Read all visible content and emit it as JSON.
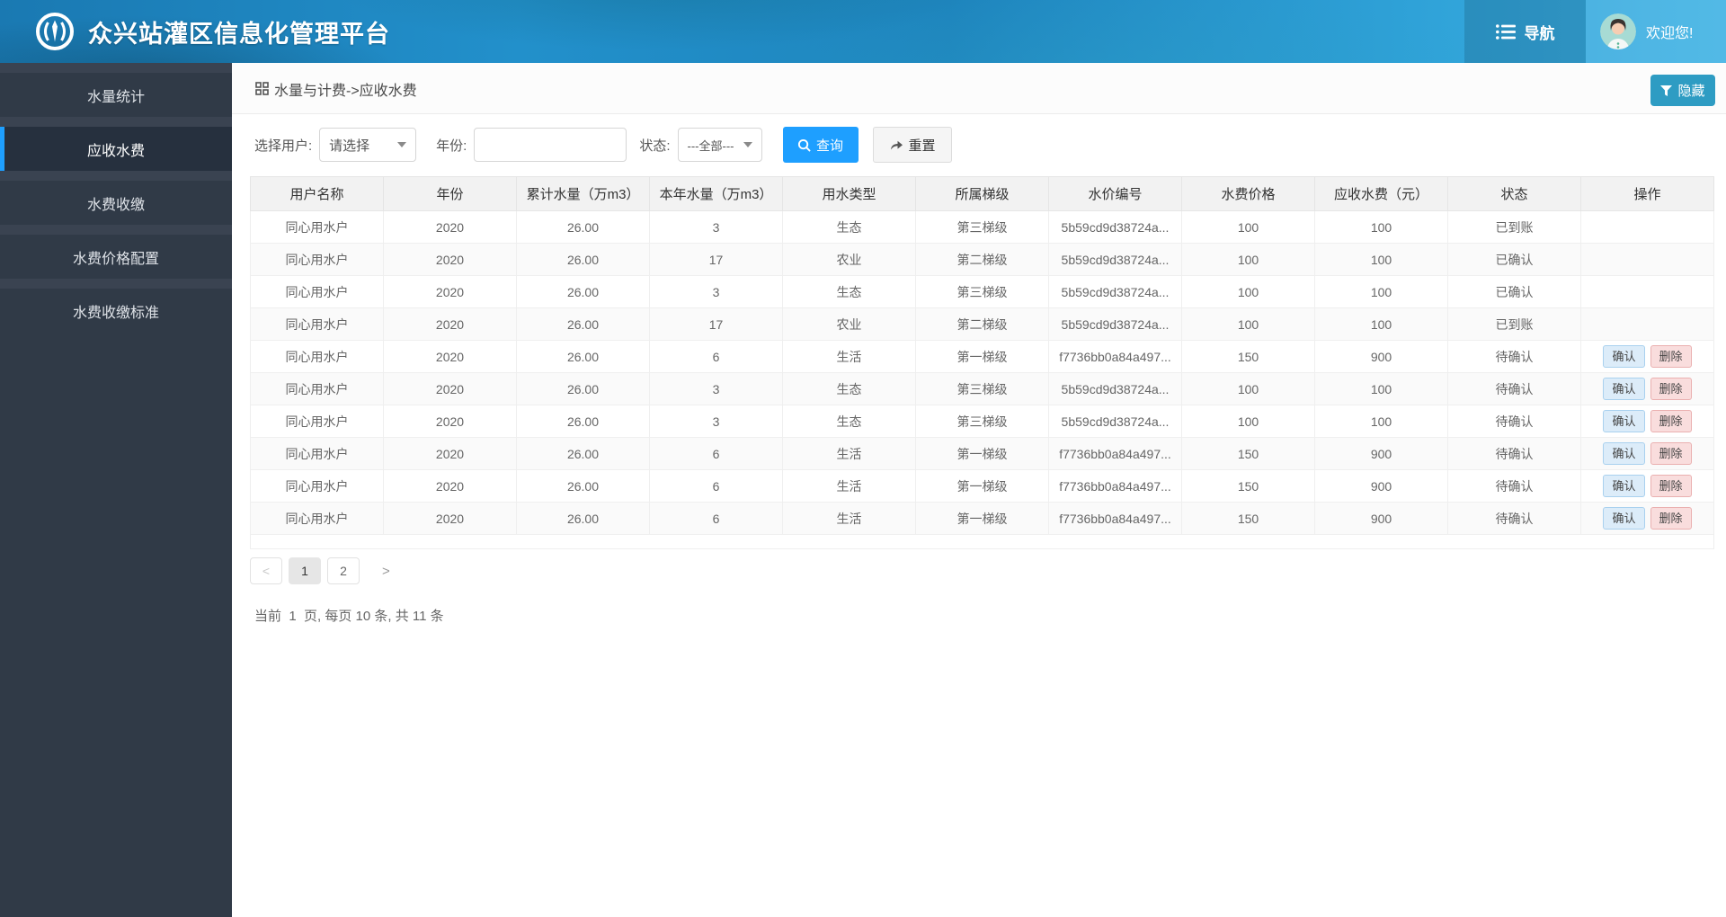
{
  "header": {
    "title": "众兴站灌区信息化管理平台",
    "nav_label": "导航",
    "welcome": "欢迎您!"
  },
  "sidebar": {
    "items": [
      {
        "key": "water-stats",
        "label": "水量统计",
        "active": false
      },
      {
        "key": "receivable-fees",
        "label": "应收水费",
        "active": true
      },
      {
        "key": "fee-collection",
        "label": "水费收缴",
        "active": false
      },
      {
        "key": "fee-price-config",
        "label": "水费价格配置",
        "active": false
      },
      {
        "key": "fee-collection-standard",
        "label": "水费收缴标准",
        "active": false
      }
    ]
  },
  "breadcrumb": {
    "text": "水量与计费->应收水费"
  },
  "toolbar": {
    "hide_label": "隐藏"
  },
  "filters": {
    "user_label": "选择用户:",
    "user_value": "请选择",
    "year_label": "年份:",
    "year_value": "",
    "status_label": "状态:",
    "status_value": "---全部---",
    "search_label": "查询",
    "reset_label": "重置"
  },
  "table": {
    "columns": [
      "用户名称",
      "年份",
      "累计水量（万m3）",
      "本年水量（万m3）",
      "用水类型",
      "所属梯级",
      "水价编号",
      "水费价格",
      "应收水费（元）",
      "状态",
      "操作"
    ],
    "confirm_label": "确认",
    "delete_label": "删除",
    "rows": [
      {
        "user": "同心用水户",
        "year": "2020",
        "total": "26.00",
        "current": "3",
        "type": "生态",
        "tier": "第三梯级",
        "price_id": "5b59cd9d38724a...",
        "price": "100",
        "amount": "100",
        "status": "已到账",
        "actions": false
      },
      {
        "user": "同心用水户",
        "year": "2020",
        "total": "26.00",
        "current": "17",
        "type": "农业",
        "tier": "第二梯级",
        "price_id": "5b59cd9d38724a...",
        "price": "100",
        "amount": "100",
        "status": "已确认",
        "actions": false
      },
      {
        "user": "同心用水户",
        "year": "2020",
        "total": "26.00",
        "current": "3",
        "type": "生态",
        "tier": "第三梯级",
        "price_id": "5b59cd9d38724a...",
        "price": "100",
        "amount": "100",
        "status": "已确认",
        "actions": false
      },
      {
        "user": "同心用水户",
        "year": "2020",
        "total": "26.00",
        "current": "17",
        "type": "农业",
        "tier": "第二梯级",
        "price_id": "5b59cd9d38724a...",
        "price": "100",
        "amount": "100",
        "status": "已到账",
        "actions": false
      },
      {
        "user": "同心用水户",
        "year": "2020",
        "total": "26.00",
        "current": "6",
        "type": "生活",
        "tier": "第一梯级",
        "price_id": "f7736bb0a84a497...",
        "price": "150",
        "amount": "900",
        "status": "待确认",
        "actions": true
      },
      {
        "user": "同心用水户",
        "year": "2020",
        "total": "26.00",
        "current": "3",
        "type": "生态",
        "tier": "第三梯级",
        "price_id": "5b59cd9d38724a...",
        "price": "100",
        "amount": "100",
        "status": "待确认",
        "actions": true
      },
      {
        "user": "同心用水户",
        "year": "2020",
        "total": "26.00",
        "current": "3",
        "type": "生态",
        "tier": "第三梯级",
        "price_id": "5b59cd9d38724a...",
        "price": "100",
        "amount": "100",
        "status": "待确认",
        "actions": true
      },
      {
        "user": "同心用水户",
        "year": "2020",
        "total": "26.00",
        "current": "6",
        "type": "生活",
        "tier": "第一梯级",
        "price_id": "f7736bb0a84a497...",
        "price": "150",
        "amount": "900",
        "status": "待确认",
        "actions": true
      },
      {
        "user": "同心用水户",
        "year": "2020",
        "total": "26.00",
        "current": "6",
        "type": "生活",
        "tier": "第一梯级",
        "price_id": "f7736bb0a84a497...",
        "price": "150",
        "amount": "900",
        "status": "待确认",
        "actions": true
      },
      {
        "user": "同心用水户",
        "year": "2020",
        "total": "26.00",
        "current": "6",
        "type": "生活",
        "tier": "第一梯级",
        "price_id": "f7736bb0a84a497...",
        "price": "150",
        "amount": "900",
        "status": "待确认",
        "actions": true
      }
    ]
  },
  "pagination": {
    "prev_label": "<",
    "pages": [
      "1",
      "2"
    ],
    "current": "1",
    "next_label": ">"
  },
  "footer": {
    "summary": "当前  1  页, 每页 10 条, 共 11 条"
  },
  "icons": {
    "logo": "water-ring-logo",
    "nav": "menu-list-icon",
    "avatar": "user-avatar",
    "hide": "filter-funnel-icon",
    "search": "magnifier-icon",
    "reset": "arrow-right-icon",
    "breadcrumb": "grid-icon",
    "select_arrow": "chevron-down-triangle"
  },
  "colors": {
    "accent_blue": "#1e9fff",
    "teal_button": "#2e9cc3",
    "header_blue": "#2290cb",
    "sidebar_bg": "#303a47",
    "sidebar_active": "#26303e",
    "confirm_bg": "#dcecf9",
    "delete_bg": "#f9dddd",
    "table_header_bg": "#f2f2f2"
  }
}
